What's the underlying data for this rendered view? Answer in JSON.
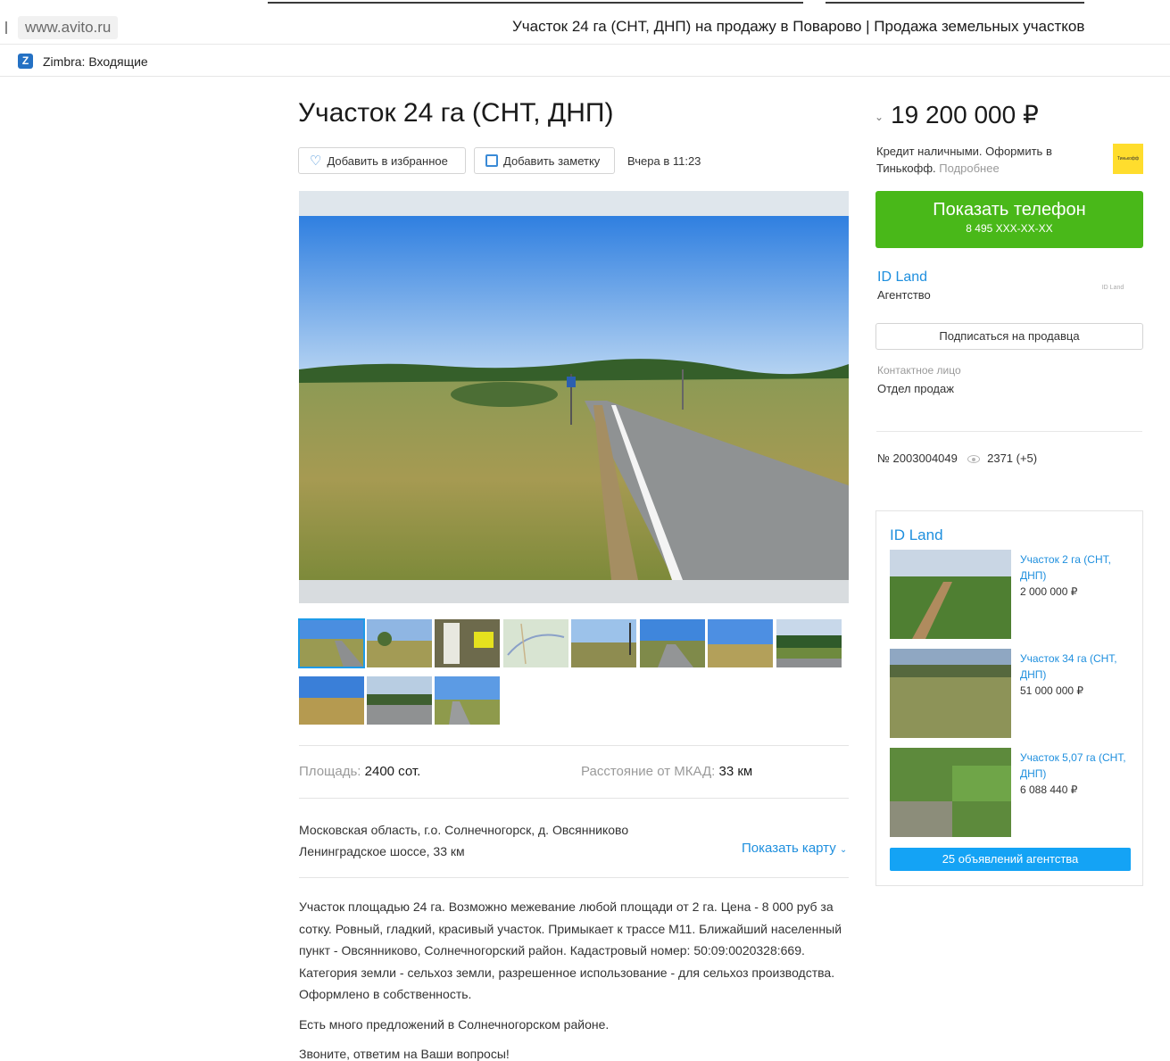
{
  "browser": {
    "url": "www.avito.ru",
    "tab_title": "Участок 24 га (СНТ, ДНП) на продажу в Поварово | Продажа земельных участков",
    "bookmark_icon": "Z",
    "bookmark_label": "Zimbra: Входящие"
  },
  "listing": {
    "title": "Участок 24 га (СНТ, ДНП)",
    "favorite_label": "Добавить в избранное",
    "note_label": "Добавить заметку",
    "posted": "Вчера в 11:23",
    "params": {
      "area_label": "Площадь:",
      "area_value": "2400 сот.",
      "distance_label": "Расстояние от МКАД:",
      "distance_value": "33 км"
    },
    "address_line1": "Московская область, г.о. Солнечногорск, д. Овсянниково",
    "address_line2": "Ленинградское шоссе, 33 км",
    "show_map": "Показать карту",
    "description": [
      "Участок площадью 24 га. Возможно межевание любой площади от 2 га. Цена - 8 000 руб за сотку. Ровный, гладкий, красивый участок. Примыкает к трассе М11. Ближайший населенный пункт - Овсянниково, Солнечногорский район. Кадастровый номер: 50:09:0020328:669. Категория земли - сельхоз земли, разрешенное использование - для сельхоз производства. Оформлено в собственность.",
      "Есть много предложений в Солнечногорском районе.",
      "Звоните, ответим на Ваши вопросы!"
    ]
  },
  "sidebar": {
    "price": "19 200 000 ₽",
    "credit_text": "Кредит наличными. Оформить в Тинькофф.",
    "credit_more": "Подробнее",
    "tinkoff_logo": "Тинькофф",
    "phone_button": "Показать телефон",
    "phone_number": "8 495 XXX-XX-XX",
    "seller_name": "ID Land",
    "seller_type": "Агентство",
    "seller_logo": "ID Land",
    "subscribe": "Подписаться на продавца",
    "contact_label": "Контактное лицо",
    "contact_value": "Отдел продаж",
    "ad_number": "№ 2003004049",
    "views": "2371 (+5)"
  },
  "agency": {
    "name": "ID Land",
    "listings": [
      {
        "title": "Участок 2 га (СНТ, ДНП)",
        "price": "2 000 000 ₽"
      },
      {
        "title": "Участок 34 га (СНТ, ДНП)",
        "price": "51 000 000 ₽"
      },
      {
        "title": "Участок 5,07 га (СНТ, ДНП)",
        "price": "6 088 440 ₽"
      }
    ],
    "all_button": "25 объявлений агентства"
  },
  "colors": {
    "link": "#1e8fde",
    "phone_green": "#49b819",
    "agency_button": "#14a3f5",
    "tinkoff_yellow": "#ffdd2d"
  },
  "icons": [
    "heart-icon",
    "note-icon",
    "chevron-down-icon",
    "eye-icon",
    "zimbra-icon"
  ]
}
